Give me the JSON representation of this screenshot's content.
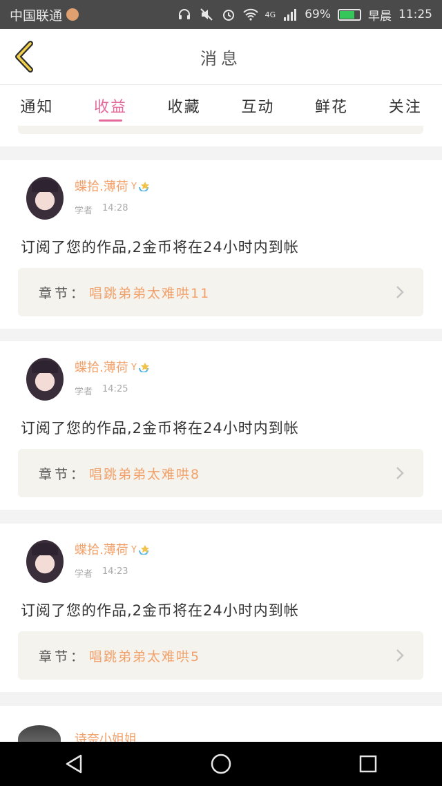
{
  "status_bar": {
    "carrier": "中国联通",
    "battery_percent": "69%",
    "signal": "4G",
    "time_prefix": "早晨",
    "time": "11:25"
  },
  "header": {
    "title": "消息"
  },
  "tabs": [
    {
      "label": "通知",
      "active": false
    },
    {
      "label": "收益",
      "active": true
    },
    {
      "label": "收藏",
      "active": false
    },
    {
      "label": "互动",
      "active": false
    },
    {
      "label": "鲜花",
      "active": false
    },
    {
      "label": "关注",
      "active": false
    }
  ],
  "messages": [
    {
      "username": "蝶拾.薄荷",
      "role": "学者",
      "time": "14:28",
      "text": "订阅了您的作品,2金币将在24小时内到帐",
      "chapter_label": "章节：",
      "chapter": "唱跳弟弟太难哄11"
    },
    {
      "username": "蝶拾.薄荷",
      "role": "学者",
      "time": "14:25",
      "text": "订阅了您的作品,2金币将在24小时内到帐",
      "chapter_label": "章节：",
      "chapter": "唱跳弟弟太难哄8"
    },
    {
      "username": "蝶拾.薄荷",
      "role": "学者",
      "time": "14:23",
      "text": "订阅了您的作品,2金币将在24小时内到帐",
      "chapter_label": "章节：",
      "chapter": "唱跳弟弟太难哄5"
    }
  ],
  "partial_message": {
    "username": "诗奈小姐姐"
  },
  "colors": {
    "accent": "#e46a9b",
    "username": "#f2a06a",
    "chapter_bg": "#f4f3ee"
  }
}
